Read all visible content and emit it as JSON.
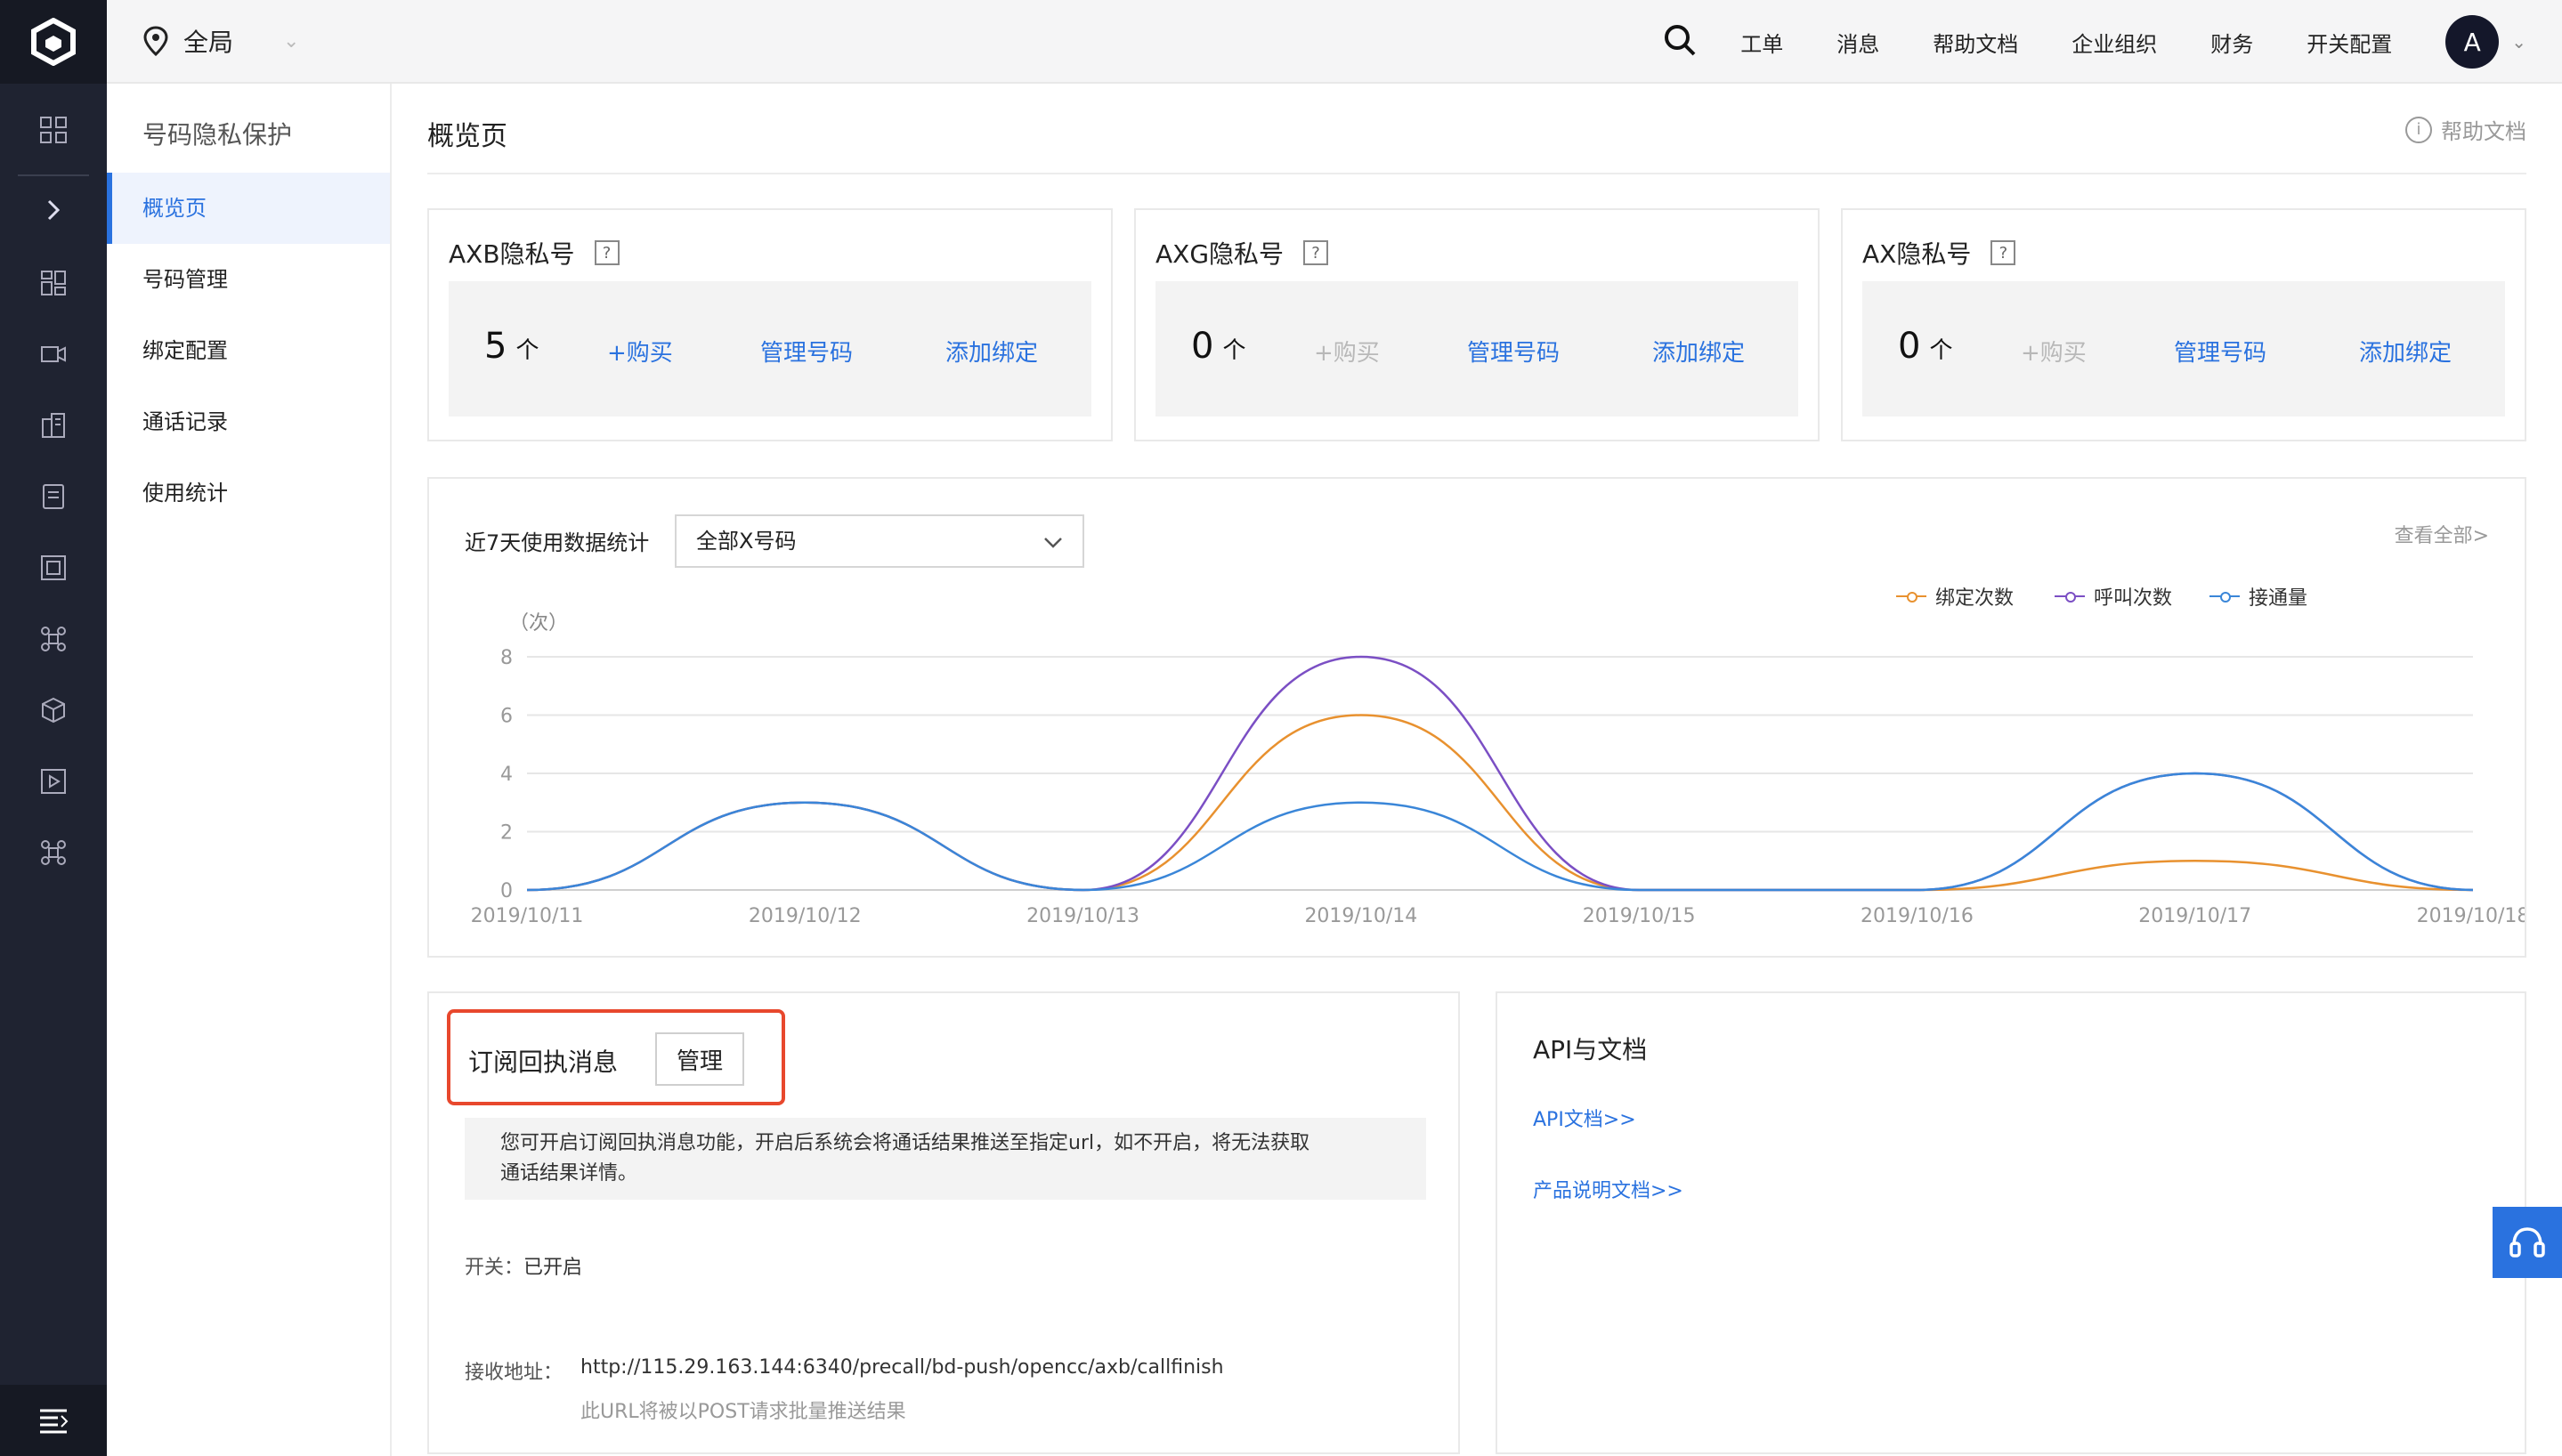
{
  "header": {
    "location": "全局",
    "nav": [
      "工单",
      "消息",
      "帮助文档",
      "企业组织",
      "财务",
      "开关配置"
    ],
    "avatar": "A"
  },
  "rail": {
    "icons": [
      "dashboard-icon",
      "expand-icon",
      "grid-icon",
      "video-icon",
      "building-icon",
      "document-icon",
      "frame-icon",
      "command-icon",
      "cube-icon",
      "play-icon",
      "command-icon-2"
    ]
  },
  "sidebar": {
    "title": "号码隐私保护",
    "items": [
      {
        "label": "概览页",
        "active": true
      },
      {
        "label": "号码管理"
      },
      {
        "label": "绑定配置"
      },
      {
        "label": "通话记录"
      },
      {
        "label": "使用统计"
      }
    ]
  },
  "page": {
    "title": "概览页",
    "help": "帮助文档"
  },
  "number_cards": [
    {
      "title": "AXB隐私号",
      "help": "?",
      "count": "5",
      "unit": "个",
      "buy": "+购买",
      "buy_enabled": true,
      "manage": "管理号码",
      "bind": "添加绑定"
    },
    {
      "title": "AXG隐私号",
      "help": "?",
      "count": "0",
      "unit": "个",
      "buy": "+购买",
      "buy_enabled": false,
      "manage": "管理号码",
      "bind": "添加绑定"
    },
    {
      "title": "AX隐私号",
      "help": "?",
      "count": "0",
      "unit": "个",
      "buy": "+购买",
      "buy_enabled": false,
      "manage": "管理号码",
      "bind": "添加绑定"
    }
  ],
  "stats": {
    "label": "近7天使用数据统计",
    "select_value": "全部X号码",
    "view_all": "查看全部>"
  },
  "chart_data": {
    "type": "line",
    "ylabel": "（次）",
    "x": [
      "2019/10/11",
      "2019/10/12",
      "2019/10/13",
      "2019/10/14",
      "2019/10/15",
      "2019/10/16",
      "2019/10/17",
      "2019/10/18"
    ],
    "yticks": [
      0,
      2,
      4,
      6,
      8
    ],
    "ylim": [
      0,
      8
    ],
    "legend_position": "top-right",
    "grid": true,
    "series": [
      {
        "name": "绑定次数",
        "color": "#e8912f",
        "values": [
          0,
          3,
          0,
          6,
          0,
          0,
          1,
          0
        ]
      },
      {
        "name": "呼叫次数",
        "color": "#7b4fc4",
        "values": [
          0,
          3,
          0,
          8,
          0,
          0,
          4,
          0
        ]
      },
      {
        "name": "接通量",
        "color": "#3a86d8",
        "values": [
          0,
          3,
          0,
          3,
          0,
          0,
          4,
          0
        ]
      }
    ]
  },
  "subscription": {
    "title": "订阅回执消息",
    "manage": "管理",
    "desc_line1": "您可开启订阅回执消息功能，开启后系统会将通话结果推送至指定url，如不开启，将无法获取",
    "desc_line2": "通话结果详情。",
    "switch_label": "开关：",
    "switch_value": "已开启",
    "url_label": "接收地址：",
    "url_value": "http://115.29.163.144:6340/precall/bd-push/opencc/axb/callfinish",
    "url_note": "此URL将被以POST请求批量推送结果"
  },
  "api": {
    "title": "API与文档",
    "links": [
      "API文档>>",
      "产品说明文档>>"
    ]
  },
  "colors": {
    "accent": "#2a72df",
    "highlight_border": "#e8482d",
    "rail_bg": "#1f2331"
  }
}
